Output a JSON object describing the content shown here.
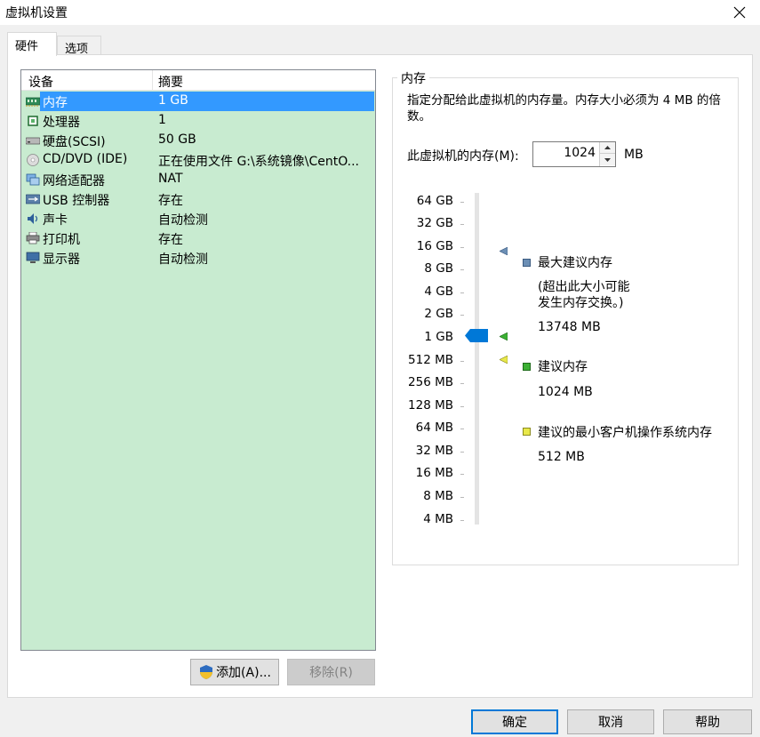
{
  "window": {
    "title": "虚拟机设置",
    "close_glyph": "✕"
  },
  "tabs": [
    {
      "label": "硬件"
    },
    {
      "label": "选项"
    }
  ],
  "device_list": {
    "header_device": "设备",
    "header_summary": "摘要",
    "rows": [
      {
        "name": "内存",
        "summary": "1 GB",
        "icon": "memory-icon"
      },
      {
        "name": "处理器",
        "summary": "1",
        "icon": "processor-icon"
      },
      {
        "name": "硬盘(SCSI)",
        "summary": "50 GB",
        "icon": "hard-disk-icon"
      },
      {
        "name": "CD/DVD (IDE)",
        "summary": "正在使用文件 G:\\系统镜像\\CentO...",
        "icon": "cd-dvd-icon"
      },
      {
        "name": "网络适配器",
        "summary": "NAT",
        "icon": "network-adapter-icon"
      },
      {
        "name": "USB 控制器",
        "summary": "存在",
        "icon": "usb-controller-icon"
      },
      {
        "name": "声卡",
        "summary": "自动检测",
        "icon": "sound-card-icon"
      },
      {
        "name": "打印机",
        "summary": "存在",
        "icon": "printer-icon"
      },
      {
        "name": "显示器",
        "summary": "自动检测",
        "icon": "display-icon"
      }
    ],
    "selected_index": 0
  },
  "buttons": {
    "add": "添加(A)...",
    "remove": "移除(R)",
    "ok": "确定",
    "cancel": "取消",
    "help": "帮助"
  },
  "memory": {
    "group_title": "内存",
    "description": "指定分配给此虚拟机的内存量。内存大小必须为 4 MB 的倍数。",
    "field_label": "此虚拟机的内存(M):",
    "value": "1024",
    "unit": "MB",
    "scale_labels": [
      "64 GB",
      "32 GB",
      "16 GB",
      "8 GB",
      "4 GB",
      "2 GB",
      "1 GB",
      "512 MB",
      "256 MB",
      "128 MB",
      "64 MB",
      "32 MB",
      "16 MB",
      "8 MB",
      "4 MB"
    ],
    "legend": {
      "max_title": "最大建议内存",
      "max_note_1": "(超出此大小可能",
      "max_note_2": "发生内存交换。)",
      "max_value": "13748 MB",
      "rec_title": "建议内存",
      "rec_value": "1024 MB",
      "min_title": "建议的最小客户机操作系统内存",
      "min_value": "512 MB"
    },
    "colors": {
      "max": "#6c8fb5",
      "recommended": "#3cb034",
      "minimum": "#e8e84a",
      "thumb": "#0078d7"
    }
  }
}
